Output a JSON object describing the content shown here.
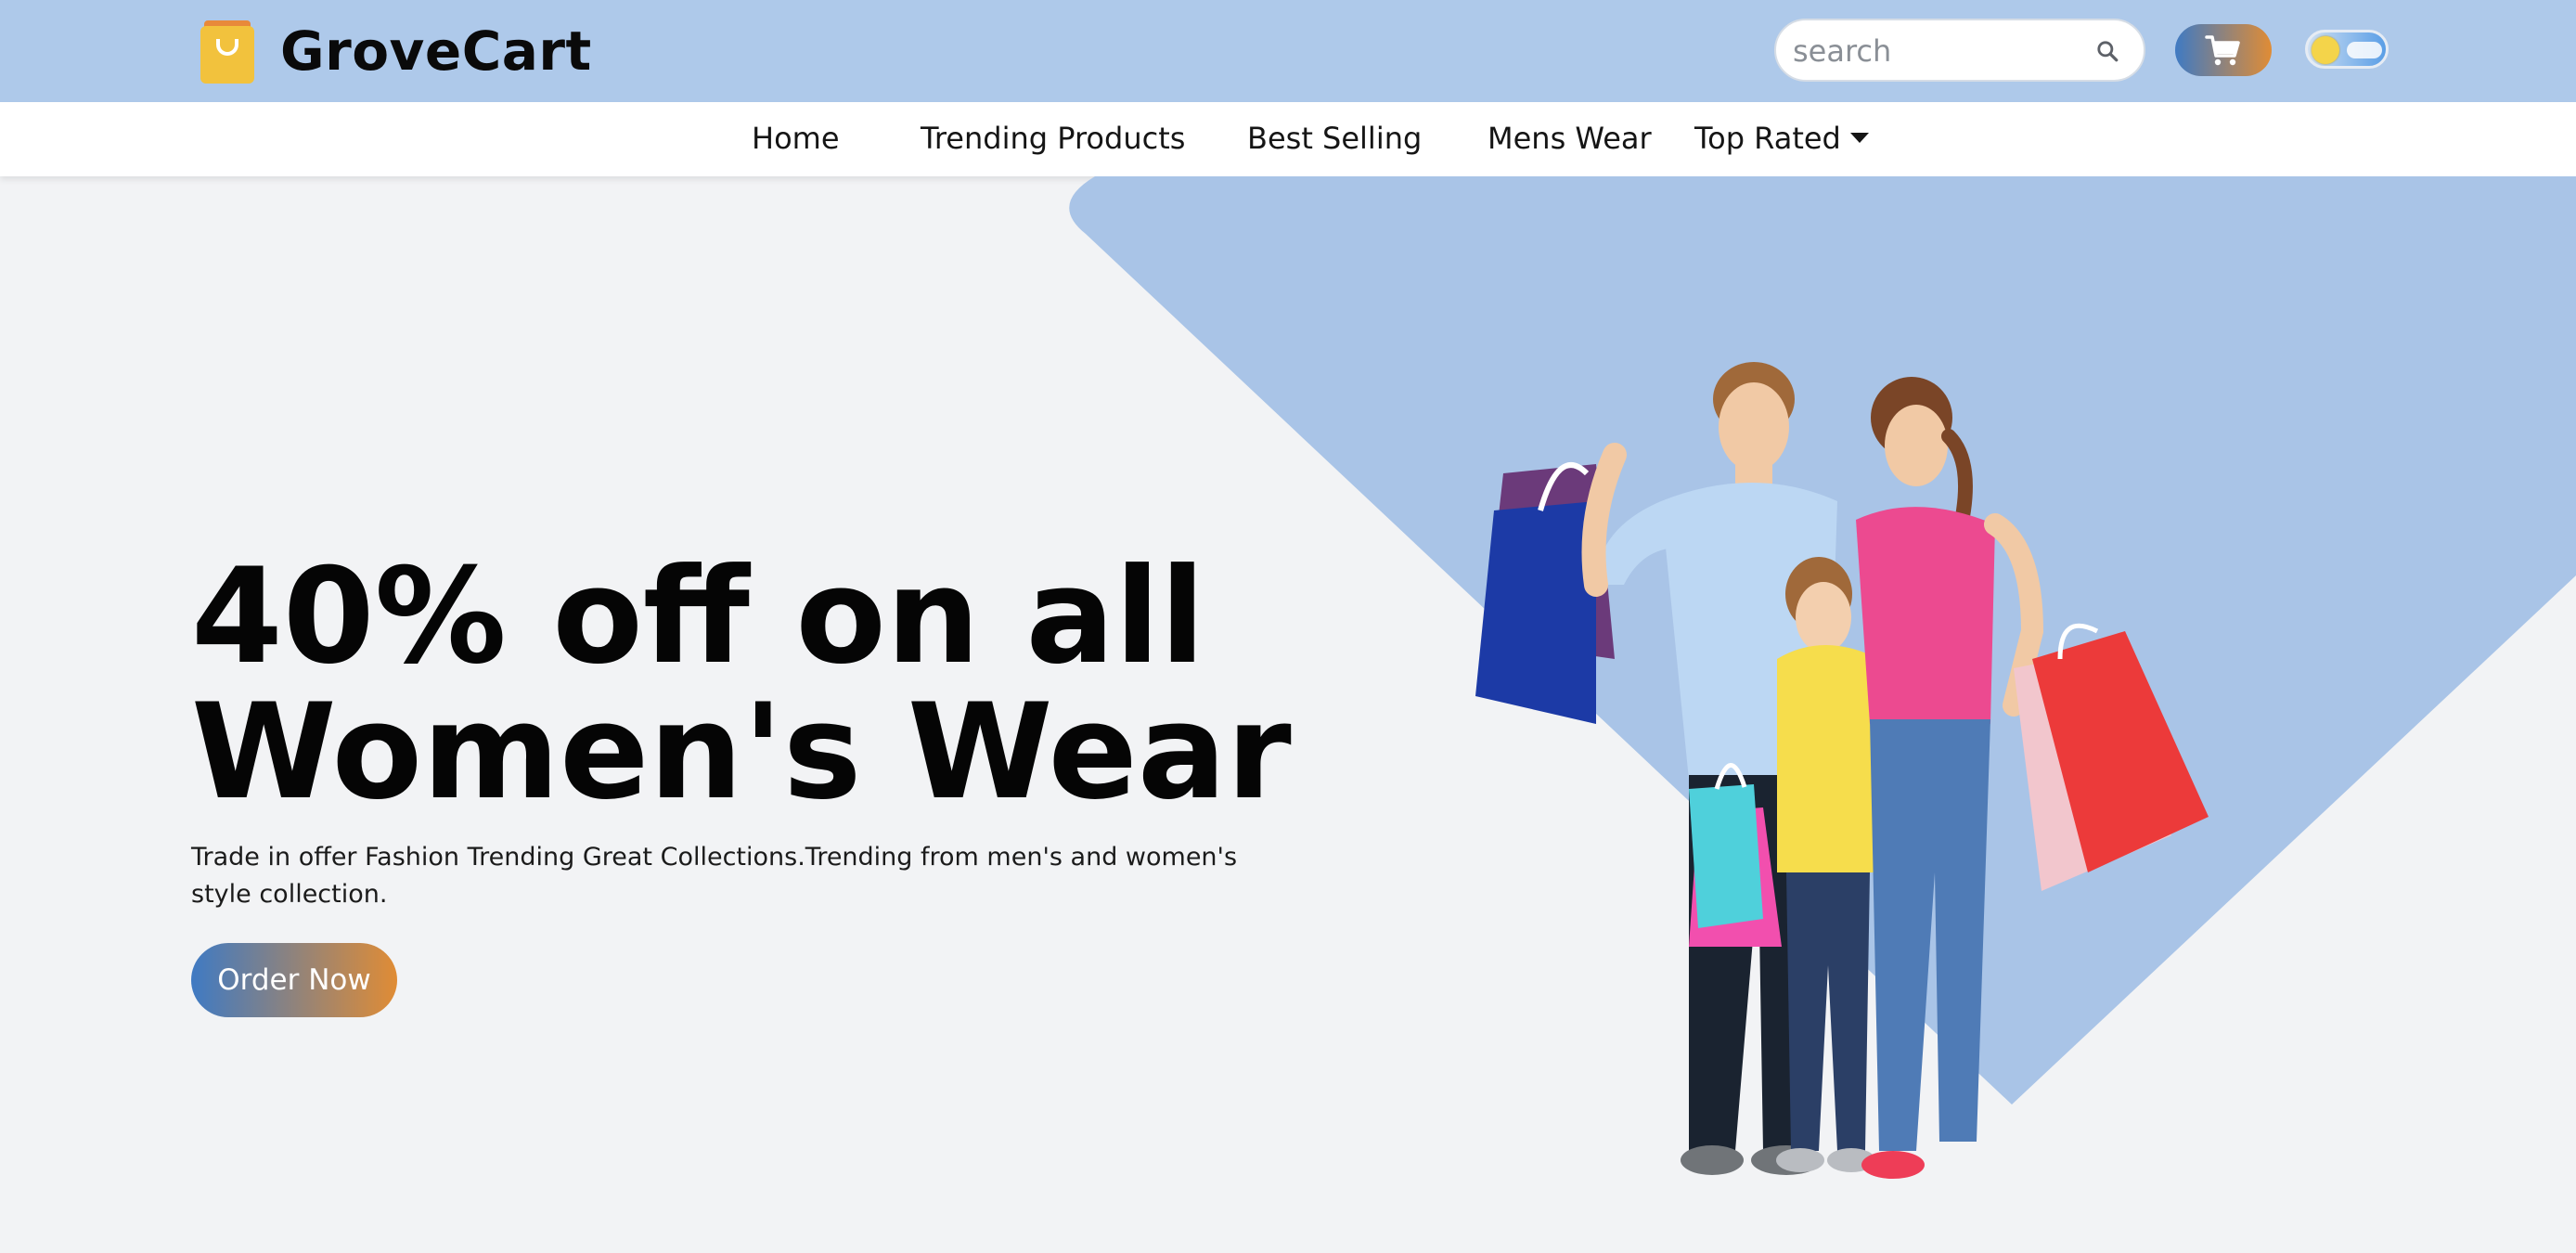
{
  "brand": {
    "name": "GroveCart",
    "logo_icon": "shopping-bag-icon"
  },
  "header": {
    "search_placeholder": "search",
    "search_icon": "search-icon",
    "cart_icon": "cart-icon",
    "theme_toggle_icon": "sun-cloud-toggle-icon"
  },
  "nav": {
    "items": [
      {
        "label": "Home"
      },
      {
        "label": "Trending Products"
      },
      {
        "label": "Best Selling"
      },
      {
        "label": "Mens Wear"
      },
      {
        "label": "Top Rated"
      }
    ],
    "dropdown_icon": "caret-down-icon"
  },
  "hero": {
    "headline_line1": "40% off on all",
    "headline_line2": "Women's Wear",
    "description": "Trade in offer Fashion Trending Great Collections.Trending from men's and women's style collection.",
    "cta_label": "Order Now",
    "image": "family-with-shopping-bags-illustration"
  },
  "colors": {
    "header_bg": "#aec9ea",
    "page_bg": "#f2f3f5",
    "accent_shape": "#a9c4e7",
    "gradient_start": "#3f7ac3",
    "gradient_end": "#e08c35",
    "logo_yellow": "#f2c23d"
  }
}
